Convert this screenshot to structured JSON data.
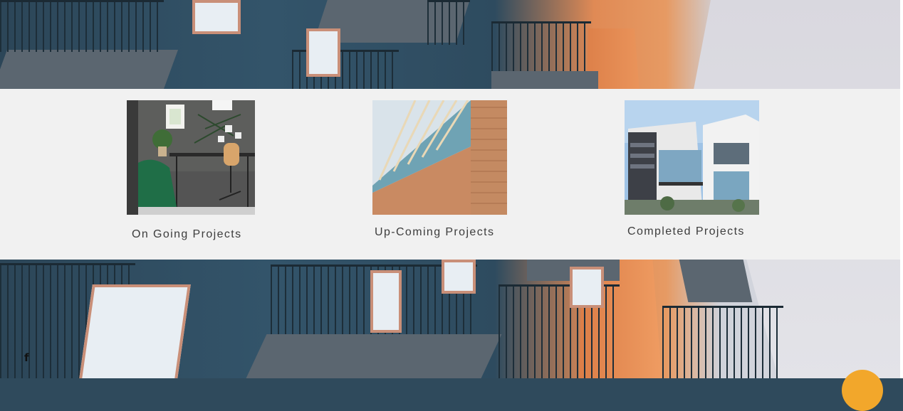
{
  "projects": [
    {
      "label": "On Going Projects",
      "image": "office-workspace-photo"
    },
    {
      "label": "Up-Coming Projects",
      "image": "modern-facade-photo"
    },
    {
      "label": "Completed Projects",
      "image": "modern-house-photo"
    }
  ],
  "social": {
    "facebook": "f"
  },
  "colors": {
    "band": "#f1f1f1",
    "caption": "#3d3d3d",
    "chat_button": "#f2a72b"
  }
}
